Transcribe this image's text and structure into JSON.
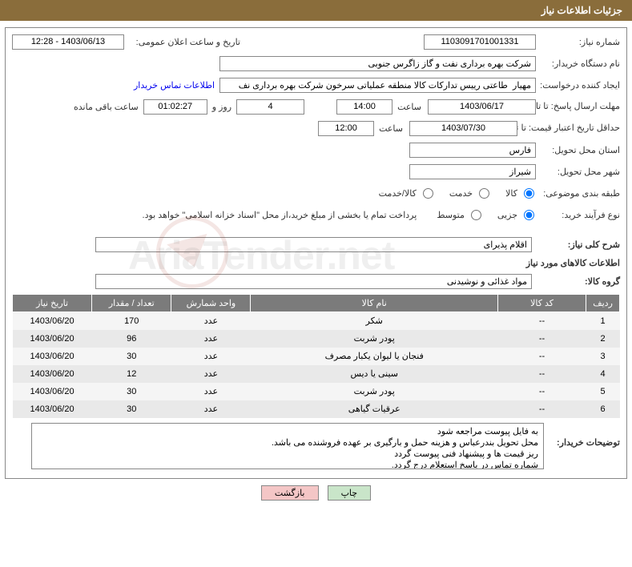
{
  "header_title": "جزئیات اطلاعات نیاز",
  "labels": {
    "need_no": "شماره نیاز:",
    "announce_dt": "تاریخ و ساعت اعلان عمومی:",
    "buyer_org": "نام دستگاه خریدار:",
    "requester": "ایجاد کننده درخواست:",
    "reply_deadline": "مهلت ارسال پاسخ: تا تاریخ:",
    "hour": "ساعت",
    "days_and": "روز و",
    "hours_remaining": "ساعت باقی مانده",
    "min_quote_valid": "حداقل تاریخ اعتبار قیمت: تا تاریخ:",
    "province": "استان محل تحویل:",
    "city": "شهر محل تحویل:",
    "classification": "طبقه بندی موضوعی:",
    "purchase_type": "نوع فرآیند خرید:",
    "summary": "شرح کلی نیاز:",
    "goods_info": "اطلاعات کالاهای مورد نیاز",
    "goods_group": "گروه کالا:",
    "buyer_notes": "توضیحات خریدار:"
  },
  "values": {
    "need_no": "1103091701001331",
    "announce_dt": "1403/06/13 - 12:28",
    "buyer_org": "شرکت بهره برداری نفت و گاز زاگرس جنوبی",
    "requester": "مهیار  طاعتی رییس تدارکات کالا منطقه عملیاتی سرخون شرکت بهره برداری نف",
    "contact_link": "اطلاعات تماس خریدار",
    "reply_date": "1403/06/17",
    "reply_hour": "14:00",
    "remaining_days": "4",
    "remaining_time": "01:02:27",
    "quote_date": "1403/07/30",
    "quote_hour": "12:00",
    "province": "فارس",
    "city": "شیراز",
    "summary_text": "اقلام پذیرای",
    "goods_group_text": "مواد غذائی و نوشیدنی"
  },
  "radios": {
    "class": {
      "goods": "کالا",
      "service": "خدمت",
      "goods_service": "کالا/خدمت"
    },
    "ptype": {
      "minor": "جزیی",
      "medium": "متوسط"
    }
  },
  "treasury_note": "پرداخت تمام یا بخشی از مبلغ خرید،از محل \"اسناد خزانه اسلامی\" خواهد بود.",
  "table": {
    "headers": [
      "ردیف",
      "کد کالا",
      "نام کالا",
      "واحد شمارش",
      "تعداد / مقدار",
      "تاریخ نیاز"
    ],
    "rows": [
      {
        "n": "1",
        "code": "--",
        "name": "شکر",
        "unit": "عدد",
        "qty": "170",
        "date": "1403/06/20"
      },
      {
        "n": "2",
        "code": "--",
        "name": "پودر شربت",
        "unit": "عدد",
        "qty": "96",
        "date": "1403/06/20"
      },
      {
        "n": "3",
        "code": "--",
        "name": "فنجان یا لیوان یکبار مصرف",
        "unit": "عدد",
        "qty": "30",
        "date": "1403/06/20"
      },
      {
        "n": "4",
        "code": "--",
        "name": "سینی یا دیس",
        "unit": "عدد",
        "qty": "12",
        "date": "1403/06/20"
      },
      {
        "n": "5",
        "code": "--",
        "name": "پودر شربت",
        "unit": "عدد",
        "qty": "30",
        "date": "1403/06/20"
      },
      {
        "n": "6",
        "code": "--",
        "name": "عرقیات گیاهی",
        "unit": "عدد",
        "qty": "30",
        "date": "1403/06/20"
      }
    ]
  },
  "buyer_notes_lines": [
    "به فایل پیوست مراجعه شود",
    "محل تحویل  بندرعباس و هزینه حمل و بارگیری  بر عهده فروشنده می باشد.",
    "ریز قیمت ها و پیشنهاد فنی پیوست گردد",
    "شماره تماس در پاسخ استعلام درج گردد."
  ],
  "buttons": {
    "print": "چاپ",
    "back": "بازگشت"
  },
  "watermark": "AriaTender.net"
}
